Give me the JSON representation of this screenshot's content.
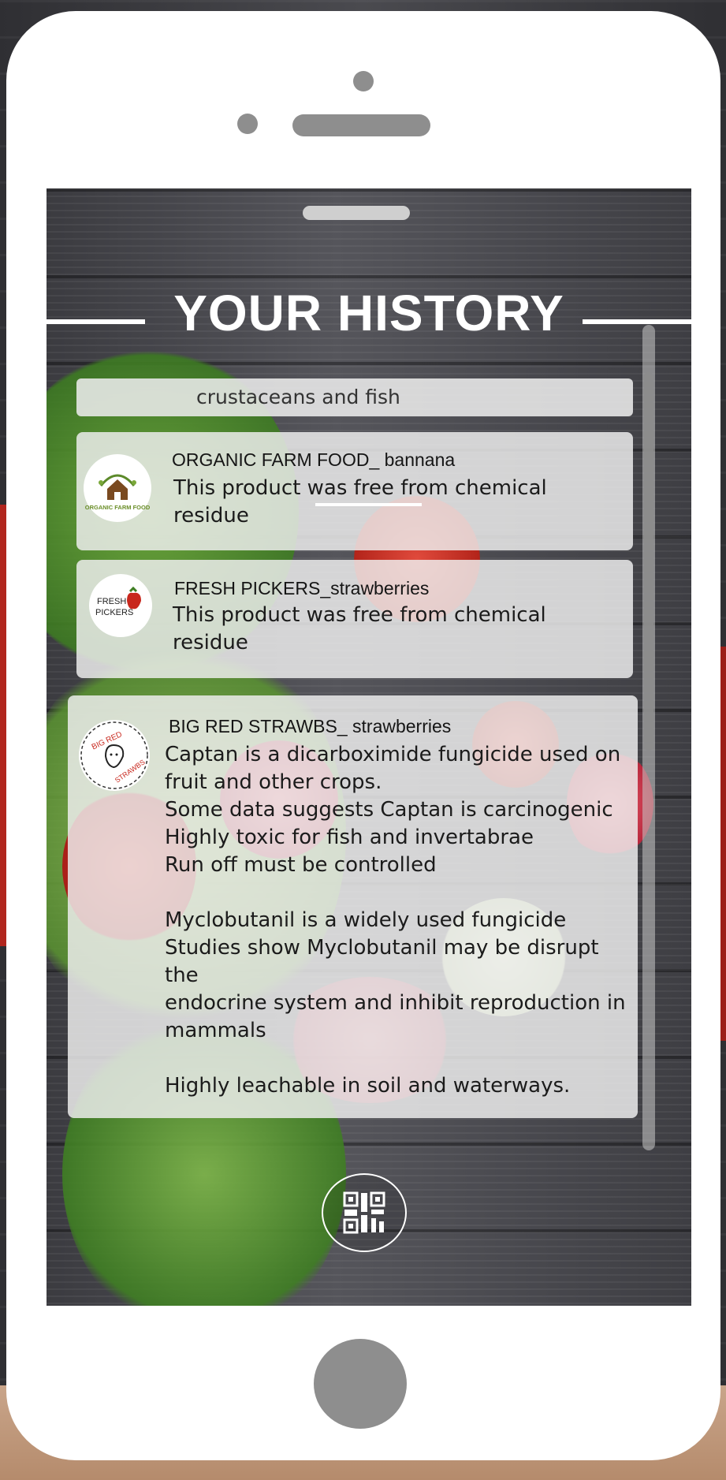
{
  "screen": {
    "title": "YOUR HISTORY",
    "search": {
      "value": "crustaceans and fish"
    },
    "history": [
      {
        "brand": "ORGANIC FARM FOOD_ bannana",
        "logo_text": "ORGANIC FARM FOOD",
        "body": [
          "This product was free from chemical",
          "residue"
        ]
      },
      {
        "brand": "FRESH PICKERS_strawberries",
        "logo_text": [
          "FRESH",
          "PICKERS"
        ],
        "body": [
          "This product was free from chemical",
          "residue"
        ]
      },
      {
        "brand": "BIG RED STRAWBS_ strawberries",
        "logo_text": [
          "BIG RED",
          "STRAWBS"
        ],
        "body": [
          "Captan is a dicarboximide fungicide used on",
          "fruit and other crops.",
          "Some data suggests Captan is carcinogenic",
          "Highly toxic for fish and invertabrae",
          "Run off must be controlled",
          "",
          "Myclobutanil is a widely used fungicide",
          "Studies show Myclobutanil may be disrupt the",
          "endocrine system and inhibit reproduction in",
          "mammals",
          "",
          "Highly leachable in soil and waterways."
        ]
      }
    ]
  },
  "icons": {
    "qr": "qr-code-icon",
    "home": "home-button"
  },
  "colors": {
    "phone": "#ffffff",
    "hardware": "#8e8e8e",
    "card": "#eeeeee",
    "title": "#ffffff"
  }
}
